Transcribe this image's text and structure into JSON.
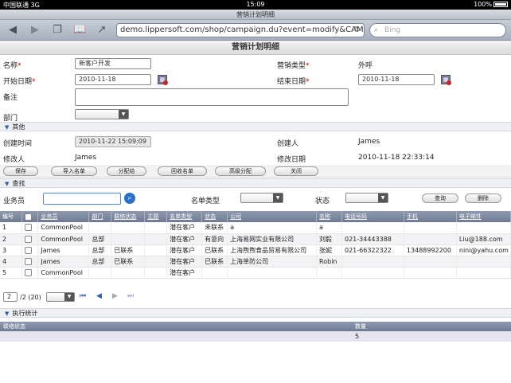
{
  "status_bar": {
    "carrier": "中国联通",
    "network": "3G",
    "time": "15:09",
    "battery": "100%"
  },
  "browser": {
    "tab_title": "营销计划明细",
    "url": "demo.lippersoft.com/shop/campaign.du?event=modify&CAMPAIG...",
    "search_placeholder": "Bing"
  },
  "page": {
    "title": "营销计划明细",
    "form": {
      "name_label": "名称",
      "name_value": "新客户开发",
      "type_label": "营销类型",
      "type_value": "外呼",
      "start_label": "开始日期",
      "start_value": "2010-11-18",
      "end_label": "结束日期",
      "end_value": "2010-11-18",
      "remark_label": "备注",
      "remark_value": "",
      "dept_label": "部门",
      "dept_value": ""
    },
    "other_section": {
      "title": "其他",
      "created_time_label": "创建时间",
      "created_time_value": "2010-11-22 15:09:09",
      "creator_label": "创建人",
      "creator_value": "James",
      "modifier_label": "修改人",
      "modifier_value": "James",
      "modified_date_label": "修改日期",
      "modified_date_value": "2010-11-18 22:33:14"
    },
    "buttons": [
      "保存",
      "导入名单",
      "分配给",
      "回收名单",
      "高级分配",
      "关闭"
    ],
    "search_section": {
      "title": "查找",
      "salesperson_label": "业务员",
      "list_type_label": "名单类型",
      "status_label": "状态",
      "query_button": "查询",
      "clear_button": "删除"
    },
    "table": {
      "columns": [
        "编号",
        "",
        "业务员",
        "部门",
        "联络状态",
        "主题",
        "名单类型",
        "状态",
        "公司",
        "名称",
        "电话号码",
        "手机",
        "电子邮件"
      ],
      "rows": [
        [
          "1",
          "",
          "CommonPool",
          "",
          "",
          "",
          "潜在客户",
          "未联系",
          "a",
          "a",
          "",
          "",
          ""
        ],
        [
          "2",
          "",
          "CommonPool",
          "总部",
          "",
          "",
          "潜在客户",
          "有意向",
          "上海易网实业有限公司",
          "刘毅",
          "021-34443388",
          "",
          "Liu@188.com"
        ],
        [
          "3",
          "",
          "James",
          "总部",
          "已联系",
          "",
          "潜在客户",
          "已联系",
          "上海煦煦食品贸易有限公司",
          "张妮",
          "021-66322322",
          "13488992200",
          "nini@yahu.com"
        ],
        [
          "4",
          "",
          "James",
          "总部",
          "已联系",
          "",
          "潜在客户",
          "已联系",
          "上海单防公司",
          "Robin",
          "",
          "",
          ""
        ],
        [
          "5",
          "",
          "CommonPool",
          "",
          "",
          "",
          "潜在客户",
          "",
          "",
          "",
          "",
          "",
          ""
        ]
      ]
    },
    "pager": {
      "page": "2",
      "total": "/2 (20)"
    },
    "stats_section": {
      "title": "执行统计",
      "col_status": "联络状态",
      "col_count": "数量",
      "count_value": "5"
    }
  }
}
